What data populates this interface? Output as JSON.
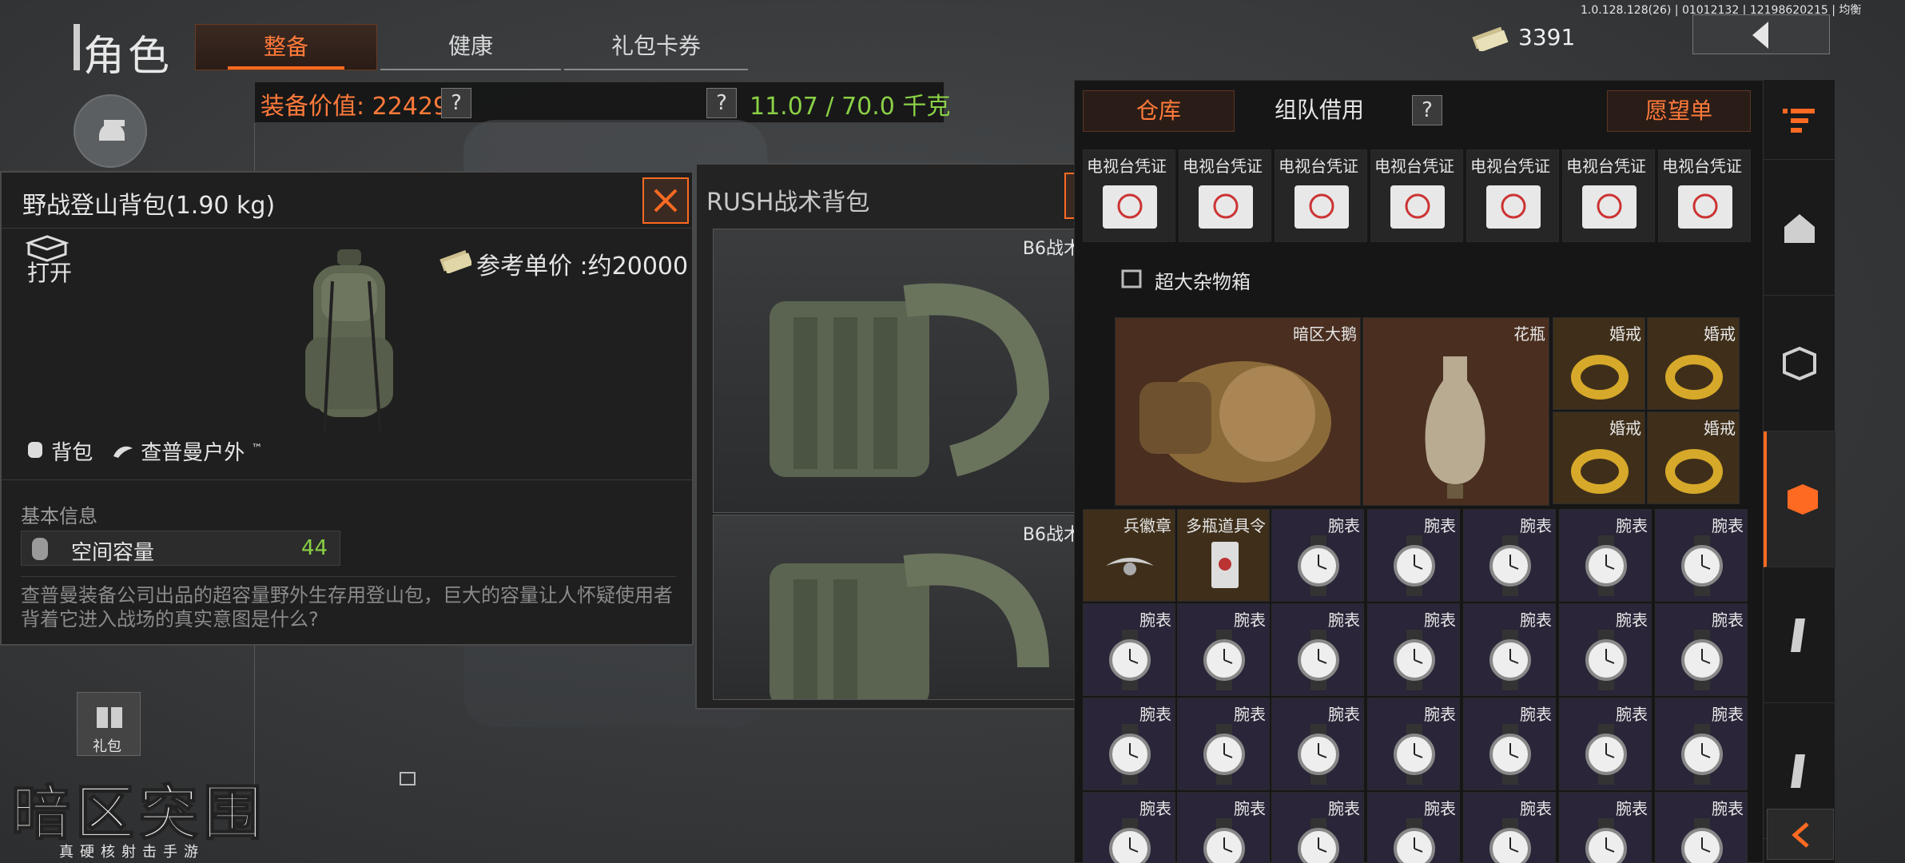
{
  "header": {
    "title": "角色",
    "tabs": [
      {
        "label": "整备",
        "active": true
      },
      {
        "label": "健康",
        "active": false
      },
      {
        "label": "礼包卡券",
        "active": false
      }
    ]
  },
  "version": "1.0.128.128(26) | 01012132 | 12198620215 | 均衡",
  "currency": {
    "amount": "3391",
    "icon": "cash-icon"
  },
  "equip_bar": {
    "value_label": "装备价值: 22429",
    "help": "?",
    "weight": "11.07 / 70.0 千克"
  },
  "item_panel": {
    "title": "野战登山背包(1.90 kg)",
    "open_label": "打开",
    "price_label": "参考单价 :约20000",
    "type_tag": "背包",
    "brand_tag": "查普曼户外",
    "brand_tm": "™",
    "basic_info": "基本信息",
    "capacity_label": "空间容量",
    "capacity_value": "44",
    "description": "查普曼装备公司出品的超容量野外生存用登山包，巨大的容量让人怀疑使用者背着它进入战场的真实意图是什么?"
  },
  "rush_panel": {
    "title": "RUSH战术背包",
    "slots": [
      {
        "label": "B6战术"
      },
      {
        "label": "B6战术"
      }
    ]
  },
  "inventory": {
    "tabs": [
      {
        "label": "仓库",
        "active": true
      },
      {
        "label": "组队借用",
        "active": false
      },
      {
        "label": "?",
        "active": false
      },
      {
        "label": "愿望单",
        "active": false
      }
    ],
    "tv_cert_label": "电视台凭证",
    "container_label": "超大杂物箱",
    "big_items": [
      {
        "label": "暗区大鹅",
        "rarity": "orange"
      },
      {
        "label": "花瓶",
        "rarity": "orange"
      }
    ],
    "ring_label": "婚戒",
    "badge_label": "兵徽章",
    "order_label": "多瓶道具令",
    "watch_label": "腕表"
  },
  "sidebar": {
    "left_gift_label": "礼包"
  },
  "logo": {
    "main": "暗区突围",
    "sub": "真硬核射击手游"
  },
  "colors": {
    "accent": "#ff6a22",
    "green_value": "#8ad045",
    "gold_cell": "#3f2f1a",
    "purple_cell": "#2a2538",
    "orange_cell": "#4a2e1f"
  }
}
